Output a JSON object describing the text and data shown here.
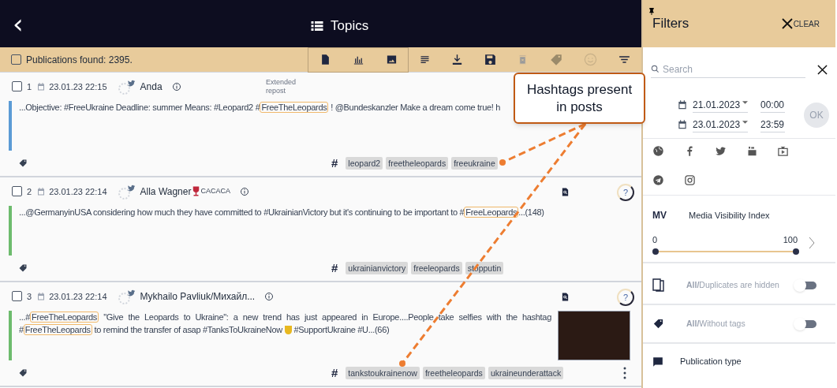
{
  "header": {
    "back": "‹",
    "title": "Topics"
  },
  "toolbar": {
    "checked": false,
    "found": "Publications found: 2395."
  },
  "posts": [
    {
      "number": "1",
      "checked": false,
      "date": "23.01.23 22:15",
      "author": "Anda",
      "repost": "Extended repost",
      "color": "#5b9bd5",
      "scored": false,
      "image": false,
      "menu": false,
      "segments": [
        {
          "kind": "text",
          "text": "...Objective: #FreeUkraine Deadline: summer Means: #Leopard2 #"
        },
        {
          "kind": "hashtag",
          "text": "FreeTheLeopards"
        },
        {
          "kind": "text",
          "text": " ! @Bundeskanzler Make a dream come true! h"
        }
      ],
      "tag_marker": "#",
      "tags": [
        "leopard2",
        "freetheleopards",
        "freeukraine"
      ]
    },
    {
      "number": "2",
      "checked": false,
      "date": "23.01.23 22:14",
      "author": "Alla Wagner",
      "author_badge": "CACACA",
      "color": "#6dbb6d",
      "scored": true,
      "image": false,
      "menu": false,
      "segments": [
        {
          "kind": "text",
          "text": "...@GermanyinUSA considering how much they have committed to #UkrainianVictory but it's continuing to be important to #"
        },
        {
          "kind": "hashtag",
          "text": "FreeLeopards"
        },
        {
          "kind": "text",
          "text": "...(148)"
        }
      ],
      "score": "?",
      "tag_marker": "#",
      "tags": [
        "ukrainianvictory",
        "freeleopards",
        "stopputin"
      ]
    },
    {
      "number": "3",
      "checked": false,
      "date": "23.01.23 22:14",
      "author": "Mykhailo Pavliuk/Михайл...",
      "color": "#6dbb6d",
      "scored": true,
      "image": true,
      "menu": true,
      "segments": [
        {
          "kind": "text",
          "text": "...#"
        },
        {
          "kind": "hashtag",
          "text": "FreeTheLeopards"
        },
        {
          "kind": "text",
          "text": " \"Give the Leopards to Ukraine\": a new trend has just appeared in Europe....People take selfies with the hashtag #"
        },
        {
          "kind": "hashtag",
          "text": "FreeTheLeopards"
        },
        {
          "kind": "text",
          "text": " to remind the transfer of asap #TanksToUkraineNow "
        },
        {
          "kind": "emoji"
        },
        {
          "kind": "text",
          "text": " #SupportUkraine #U...(66)"
        }
      ],
      "score": "?",
      "tag_marker": "#",
      "tags": [
        "tankstoukrainenow",
        "freetheleopards",
        "ukraineunderattack"
      ]
    }
  ],
  "callout": {
    "text": "Hashtags present in posts"
  },
  "filters": {
    "title": "Filters",
    "clear": "CLEAR",
    "search": {
      "placeholder": "Search"
    },
    "dates": [
      {
        "date": "21.01.2023",
        "time": "00:00"
      },
      {
        "date": "23.01.2023",
        "time": "23:59"
      }
    ],
    "ok": {
      "label": "OK",
      "disabled": true
    },
    "mv": {
      "badge": "MV",
      "label": "Media Visibility Index",
      "min": "0",
      "max": "100",
      "level": 1
    },
    "toggles": [
      {
        "label": "**All/**Duplicates are hidden",
        "on": false,
        "kind": "duplicates"
      },
      {
        "label": "**All/**Without tags",
        "on": false,
        "kind": "tags"
      }
    ],
    "publication_type": "Publication type"
  }
}
